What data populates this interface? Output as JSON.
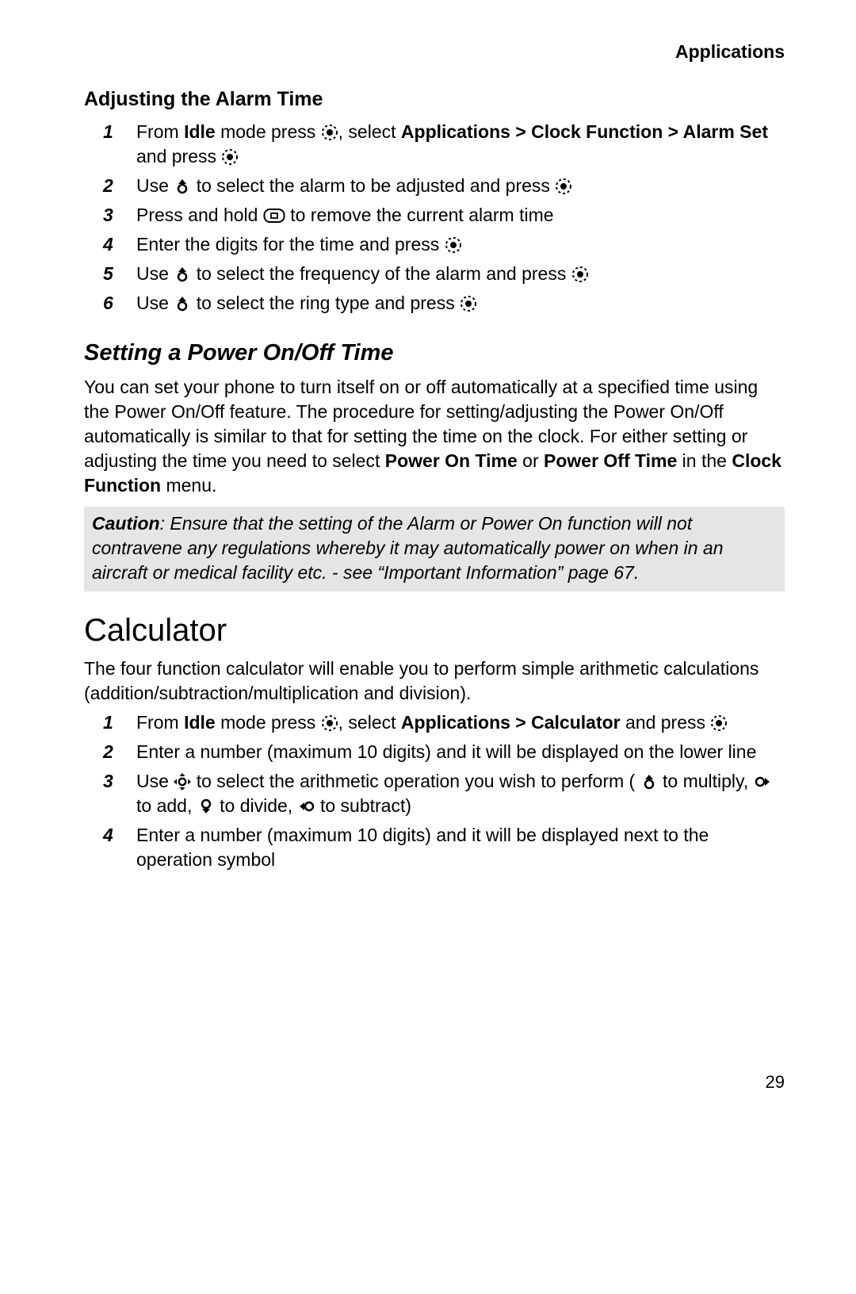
{
  "header": {
    "section": "Applications"
  },
  "alarm": {
    "heading": "Adjusting the Alarm Time",
    "steps": {
      "s1_a": "From ",
      "s1_b": "Idle",
      "s1_c": " mode press ",
      "s1_d": ", select ",
      "s1_e": "Applications > Clock Function > Alarm Set",
      "s1_f": " and press ",
      "s2_a": "Use ",
      "s2_b": " to select the alarm to be adjusted and press ",
      "s3_a": "Press and hold ",
      "s3_b": " to remove the current alarm time",
      "s4_a": "Enter the digits for the time and press ",
      "s5_a": "Use ",
      "s5_b": " to select the frequency of the alarm and press ",
      "s6_a": "Use ",
      "s6_b": " to select the ring type and press "
    }
  },
  "power": {
    "heading": "Setting a Power On/Off Time",
    "p1_a": "You can set your phone to turn itself on or off automatically at a specified time using the Power On/Off feature. The procedure for setting/adjusting the Power On/Off automatically is similar to that for setting the time on the clock. For either setting or adjusting the time you need to select ",
    "p1_b": "Power On Time",
    "p1_c": " or ",
    "p1_d": "Power Off Time",
    "p1_e": " in the ",
    "p1_f": "Clock Function",
    "p1_g": " menu.",
    "caution_lead": "Caution",
    "caution_body": ": Ensure that the setting of the Alarm or Power On function will not contravene any regulations whereby it may automatically power on when in an aircraft or medical facility etc. - see “Important Information” page 67."
  },
  "calculator": {
    "heading": "Calculator",
    "intro": "The four function calculator will enable you to perform simple arithmetic calculations (addition/subtraction/multiplication and division).",
    "steps": {
      "s1_a": "From ",
      "s1_b": "Idle",
      "s1_c": " mode press ",
      "s1_d": ", select ",
      "s1_e": "Applications > Calculator",
      "s1_f": " and press ",
      "s2": "Enter a number (maximum 10 digits) and it will be displayed on the lower line",
      "s3_a": "Use ",
      "s3_b": " to select the arithmetic operation you wish to perform (",
      "s3_c": " to multiply, ",
      "s3_d": " to add, ",
      "s3_e": " to divide, ",
      "s3_f": " to subtract)",
      "s4": "Enter a number (maximum 10 digits) and it will be displayed next to the operation symbol"
    }
  },
  "page_number": "29"
}
